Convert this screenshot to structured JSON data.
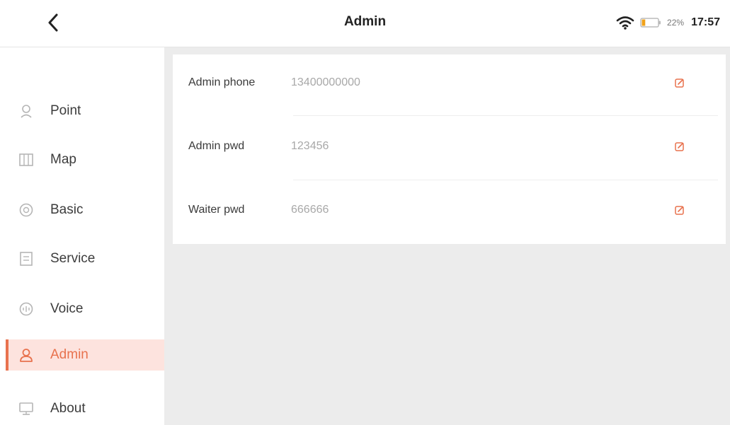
{
  "status_bar": {
    "title": "Admin",
    "battery_percent": "22%",
    "battery_level": 0.22,
    "time": "17:57",
    "icons": {
      "back": "chevron-left-icon",
      "wifi": "wifi-icon",
      "battery": "battery-icon"
    }
  },
  "sidebar": {
    "items": [
      {
        "label": "Point",
        "icon": "location-pin-icon",
        "active": false
      },
      {
        "label": "Map",
        "icon": "map-icon",
        "active": false
      },
      {
        "label": "Basic",
        "icon": "basic-settings-icon",
        "active": false
      },
      {
        "label": "Service",
        "icon": "service-document-icon",
        "active": false
      },
      {
        "label": "Voice",
        "icon": "voice-icon",
        "active": false
      },
      {
        "label": "Admin",
        "icon": "admin-user-icon",
        "active": true
      },
      {
        "label": "About",
        "icon": "about-monitor-icon",
        "active": false
      }
    ]
  },
  "settings": {
    "rows": [
      {
        "label": "Admin phone",
        "value": "13400000000",
        "icon": "edit-icon"
      },
      {
        "label": "Admin pwd",
        "value": "123456",
        "icon": "edit-icon"
      },
      {
        "label": "Waiter pwd",
        "value": "666666",
        "icon": "edit-icon"
      }
    ]
  },
  "colors": {
    "accent": "#e8724e",
    "active_bg": "#fde3de",
    "background": "#ececec",
    "panel": "#ffffff",
    "value_text": "#a8a8a8"
  }
}
